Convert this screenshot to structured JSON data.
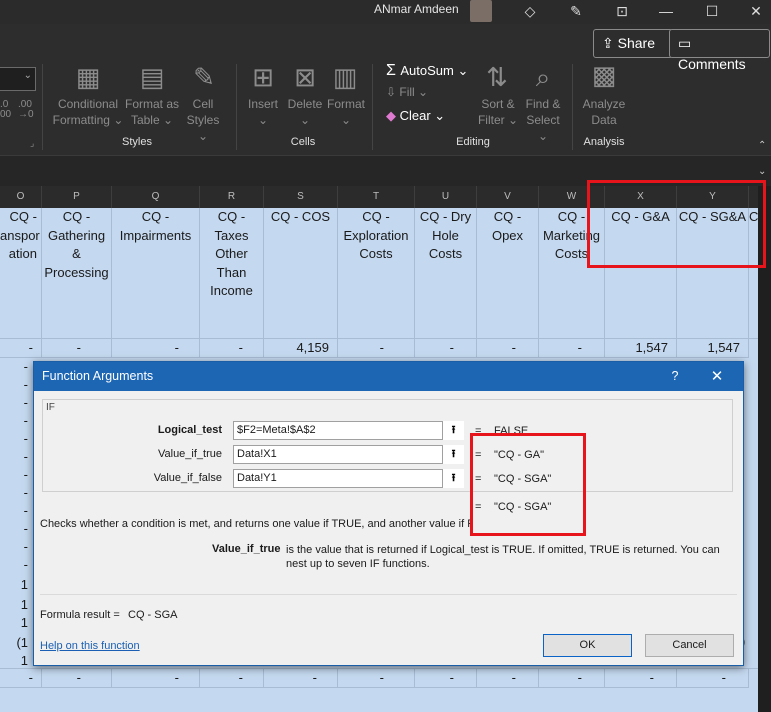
{
  "titlebar": {
    "user": "ANmar Amdeen"
  },
  "ribbon": {
    "share": "Share",
    "comments": "Comments",
    "styles": {
      "conditional": "Conditional",
      "conditional2": "Formatting",
      "format_as": "Format as",
      "format_as2": "Table",
      "cell": "Cell",
      "cell2": "Styles",
      "group": "Styles"
    },
    "cells": {
      "insert": "Insert",
      "delete": "Delete",
      "format": "Format",
      "group": "Cells"
    },
    "editing": {
      "autosum": "AutoSum",
      "fill": "Fill",
      "clear": "Clear",
      "sort": "Sort &",
      "sort2": "Filter",
      "find": "Find &",
      "find2": "Select",
      "group": "Editing"
    },
    "analysis": {
      "analyze": "Analyze",
      "analyze2": "Data",
      "group": "Analysis"
    },
    "num_a": ".0",
    "num_a2": "00",
    "num_b": ".00",
    "num_b2": "→0"
  },
  "columns": [
    {
      "letter": "O",
      "header": "CQ - Transpor tation"
    },
    {
      "letter": "P",
      "header": "CQ - Gathering & Processing"
    },
    {
      "letter": "Q",
      "header": "CQ - Impairments"
    },
    {
      "letter": "R",
      "header": "CQ - Taxes Other Than Income"
    },
    {
      "letter": "S",
      "header": "CQ - COS"
    },
    {
      "letter": "T",
      "header": "CQ - Exploration Costs"
    },
    {
      "letter": "U",
      "header": "CQ - Dry Hole Costs"
    },
    {
      "letter": "V",
      "header": "CQ - Opex"
    },
    {
      "letter": "W",
      "header": "CQ - Marketing Costs"
    },
    {
      "letter": "X",
      "header": "CQ - G&A"
    },
    {
      "letter": "Y",
      "header": "CQ - SG&A"
    },
    {
      "letter": "Z",
      "header": "C"
    }
  ],
  "col_letters": {
    "O": "O",
    "P": "P",
    "Q": "Q",
    "R": "R",
    "S": "S",
    "T": "T",
    "U": "U",
    "V": "V",
    "W": "W",
    "X": "X",
    "Y": "Y"
  },
  "header_lines": {
    "o": [
      "CQ -",
      "anspor",
      "ation"
    ],
    "p": [
      "CQ -",
      "Gathering",
      "&",
      "Processing"
    ],
    "q": [
      "CQ -",
      "Impairments"
    ],
    "r": [
      "CQ -",
      "Taxes",
      "Other",
      "Than",
      "Income"
    ],
    "s": [
      "CQ - COS"
    ],
    "t": [
      "CQ -",
      "Exploration",
      "Costs"
    ],
    "u": [
      "CQ - Dry",
      "Hole",
      "Costs"
    ],
    "v": [
      "CQ -",
      "Opex"
    ],
    "w": [
      "CQ -",
      "Marketing",
      "Costs"
    ],
    "x": [
      "CQ - G&A"
    ],
    "y": [
      "CQ - SG&A"
    ],
    "z": [
      "C"
    ]
  },
  "row1": {
    "o": "-",
    "p": "-",
    "q": "-",
    "r": "-",
    "s": "4,159",
    "t": "-",
    "u": "-",
    "v": "-",
    "w": "-",
    "x": "1,547",
    "y": "1,547"
  },
  "left_values": [
    "-",
    "-",
    "-",
    "-",
    "-",
    "-",
    "-",
    "-",
    "-",
    "-",
    "-",
    "-",
    "1",
    "1",
    "1",
    "(1",
    "1",
    "-",
    "-"
  ],
  "bottom_row": {
    "o": "-",
    "p": "-",
    "q": "-",
    "r": "-",
    "s": "-",
    "t": "-",
    "u": "-",
    "v": "-",
    "w": "-",
    "x": "-",
    "y": "-"
  },
  "right_paren": ")",
  "dialog": {
    "title": "Function Arguments",
    "help_q": "?",
    "function": "IF",
    "args": [
      {
        "label": "Logical_test",
        "value": "$F2=Meta!$A$2",
        "result": "FALSE"
      },
      {
        "label": "Value_if_true",
        "value": "Data!X1",
        "result": "\"CQ - GA\""
      },
      {
        "label": "Value_if_false",
        "value": "Data!Y1",
        "result": "\"CQ - SGA\""
      }
    ],
    "overall_result": "\"CQ - SGA\"",
    "equals": "=",
    "description": "Checks whether a condition is met, and returns one value if TRUE, and another value if FALSE.",
    "arg_name": "Value_if_true",
    "arg_desc": "is the value that is returned if Logical_test is TRUE. If omitted, TRUE is returned. You can nest up to seven IF functions.",
    "formula_result_label": "Formula result =",
    "formula_result": "CQ - SGA",
    "help_link": "Help on this function",
    "ok": "OK",
    "cancel": "Cancel"
  }
}
